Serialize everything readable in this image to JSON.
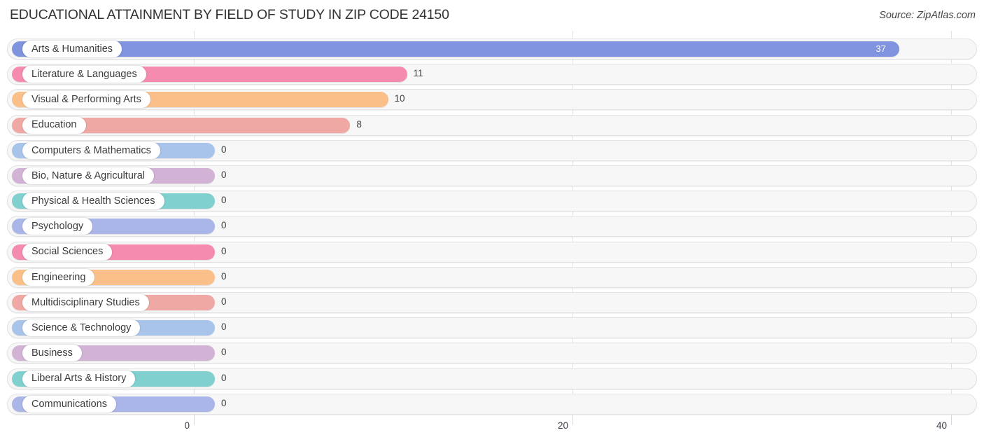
{
  "header": {
    "title": "EDUCATIONAL ATTAINMENT BY FIELD OF STUDY IN ZIP CODE 24150",
    "source": "Source: ZipAtlas.com"
  },
  "chart_data": {
    "type": "bar",
    "orientation": "horizontal",
    "title": "EDUCATIONAL ATTAINMENT BY FIELD OF STUDY IN ZIP CODE 24150",
    "xlabel": "",
    "ylabel": "",
    "xlim": [
      0,
      40
    ],
    "grid": true,
    "legend": "none",
    "xticks": [
      "0",
      "20",
      "40"
    ],
    "xtick_values": [
      0,
      20,
      40
    ],
    "categories": [
      "Arts & Humanities",
      "Literature & Languages",
      "Visual & Performing Arts",
      "Education",
      "Computers & Mathematics",
      "Bio, Nature & Agricultural",
      "Physical & Health Sciences",
      "Psychology",
      "Social Sciences",
      "Engineering",
      "Multidisciplinary Studies",
      "Science & Technology",
      "Business",
      "Liberal Arts & History",
      "Communications"
    ],
    "values": [
      37,
      11,
      10,
      8,
      0,
      0,
      0,
      0,
      0,
      0,
      0,
      0,
      0,
      0,
      0
    ],
    "value_labels": [
      "37",
      "11",
      "10",
      "8",
      "0",
      "0",
      "0",
      "0",
      "0",
      "0",
      "0",
      "0",
      "0",
      "0",
      "0"
    ],
    "colors": [
      "#7f93de",
      "#f58cb0",
      "#fbc08a",
      "#f0a8a4",
      "#a8c4ea",
      "#d2b3d6",
      "#7fd0cf",
      "#aab6e8",
      "#f58cb0",
      "#fbc08a",
      "#f0a8a4",
      "#a8c4ea",
      "#d2b3d6",
      "#7fd0cf",
      "#aab6e8"
    ]
  },
  "palette": {
    "track_fill": "#f7f7f7",
    "track_border": "#e2e2e4",
    "gridline": "#e3e3e6",
    "text": "#3c3c3c"
  }
}
